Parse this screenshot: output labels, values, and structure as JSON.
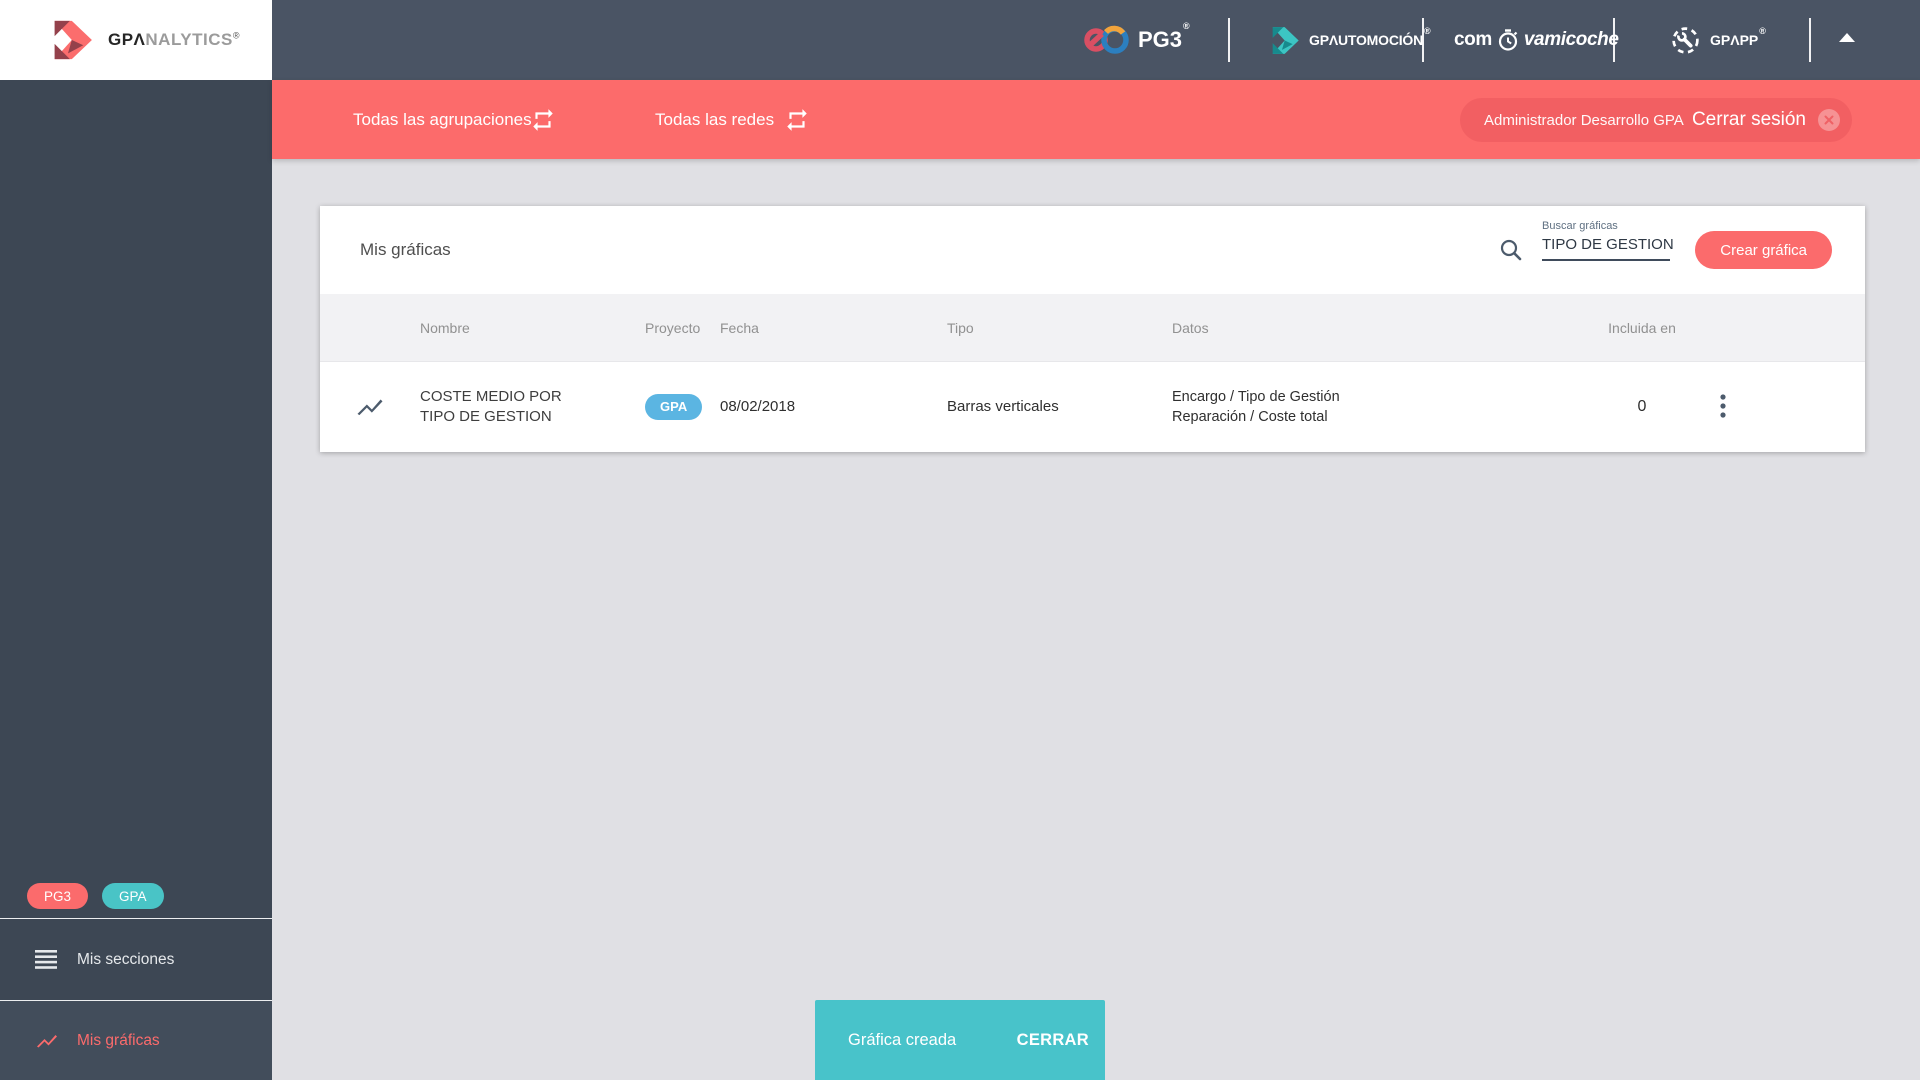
{
  "colors": {
    "accent_red": "#fc6b6b",
    "teal": "#48c3ca",
    "project_badge_blue": "#5bb5e2",
    "topbar_dark": "#4a5464",
    "sidebar_dark": "#3d4754"
  },
  "brand": {
    "logo_bold": "GPΛ",
    "logo_light": "NALYTICS",
    "logo_reg": "®"
  },
  "topbar": {
    "pg3_label": "PG3",
    "pg3_reg": "®",
    "automocion_label": "GPΛUTOMOCIÓN",
    "automocion_reg": "®",
    "comprova_prefix": "com",
    "comprova_suffix_italic": "vamicoche",
    "gpapp_label": "GPΛPP",
    "gpapp_reg": "®"
  },
  "filterbar": {
    "groupings_label": "Todas las agrupaciones",
    "networks_label": "Todas las redes",
    "user_name": "Administrador Desarrollo GPA",
    "logout_label": "Cerrar sesión"
  },
  "sidebar": {
    "badges": [
      {
        "label": "PG3"
      },
      {
        "label": "GPA"
      }
    ],
    "items": [
      {
        "label": "Mis secciones"
      },
      {
        "label": "Mis gráficas",
        "active": true
      }
    ]
  },
  "main": {
    "title": "Mis gráficas",
    "search_label": "Buscar gráficas",
    "search_value": "TIPO DE GESTION",
    "create_button_label": "Crear gráfica",
    "table": {
      "headers": {
        "name": "Nombre",
        "project": "Proyecto",
        "date": "Fecha",
        "type": "Tipo",
        "data": "Datos",
        "included": "Incluida en"
      },
      "rows": [
        {
          "name": "COSTE MEDIO POR TIPO DE GESTION",
          "project_badge": "GPA",
          "date": "08/02/2018",
          "type": "Barras verticales",
          "data_line1": "Encargo / Tipo de Gestión",
          "data_line2": "Reparación / Coste total",
          "included_in": "0"
        }
      ]
    }
  },
  "snackbar": {
    "message": "Gráfica creada",
    "action_label": "CERRAR"
  }
}
